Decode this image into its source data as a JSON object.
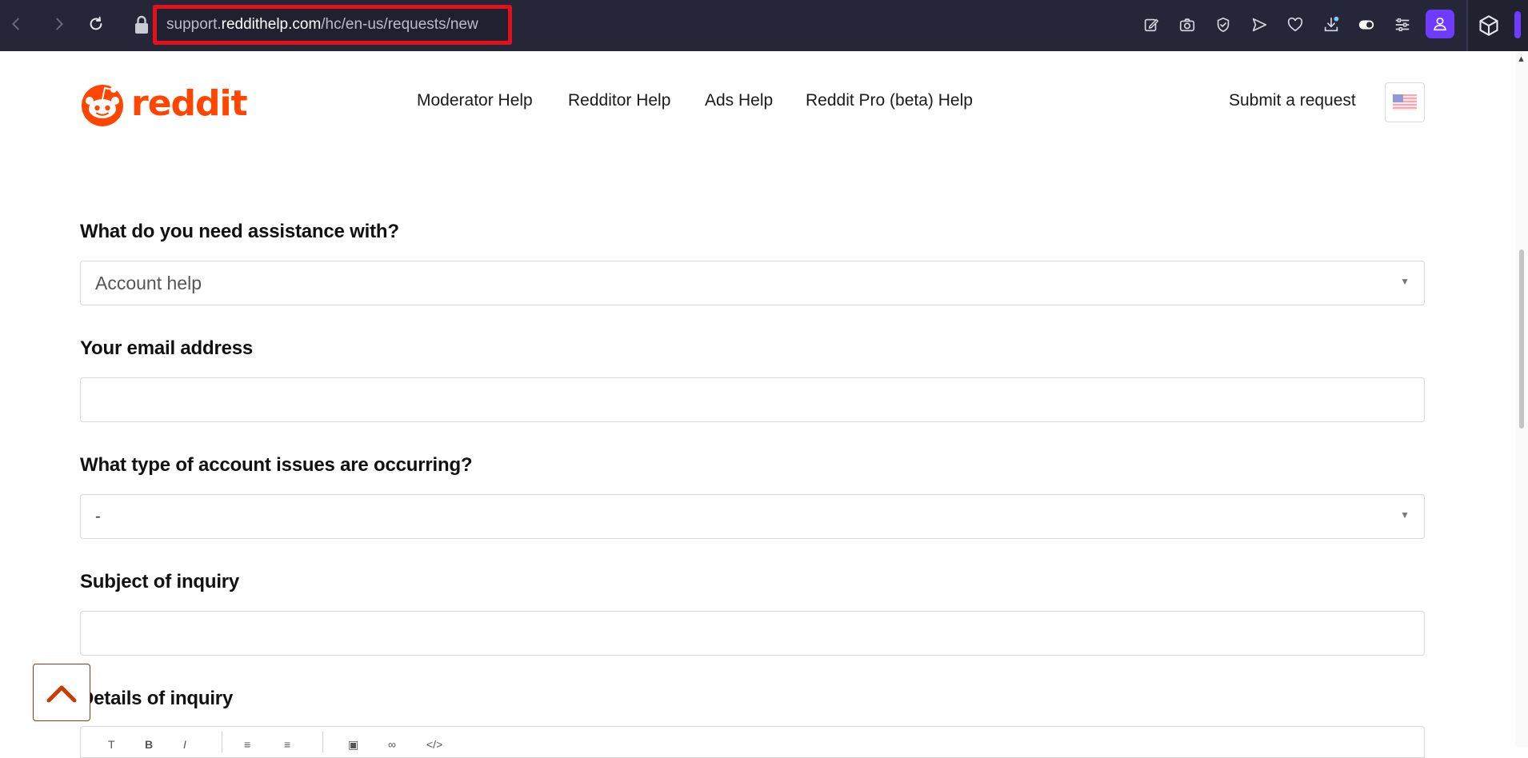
{
  "browser": {
    "url_prefix": "support.",
    "url_host": "reddithelp.com",
    "url_path": "/hc/en-us/requests/new",
    "accent_color": "#6e3bff",
    "highlight_color": "#e3101c",
    "icons": [
      "back-icon",
      "forward-icon",
      "reload-icon",
      "lock-icon",
      "edit-icon",
      "camera-icon",
      "shield-check-icon",
      "send-icon",
      "heart-icon",
      "download-icon",
      "toggle-icon",
      "sliders-icon",
      "profile-icon",
      "extension-box-icon"
    ]
  },
  "header": {
    "logo_text": "reddit",
    "brand_color": "#ff4500",
    "nav": [
      "Moderator Help",
      "Redditor Help",
      "Ads Help",
      "Reddit Pro (beta) Help"
    ],
    "submit_request": "Submit a request",
    "language_icon": "us-flag-icon"
  },
  "form": {
    "assistance_label": "What do you need assistance with?",
    "assistance_value": "Account help",
    "email_label": "Your email address",
    "email_value": "",
    "issue_type_label": "What type of account issues are occurring?",
    "issue_type_value": "-",
    "subject_label": "Subject of inquiry",
    "subject_value": "",
    "details_label": "Details of inquiry"
  },
  "editor_toolbar": [
    "T",
    "B",
    "I",
    "bulleted-list-icon",
    "numbered-list-icon",
    "image-icon",
    "link-icon",
    "code-icon"
  ]
}
